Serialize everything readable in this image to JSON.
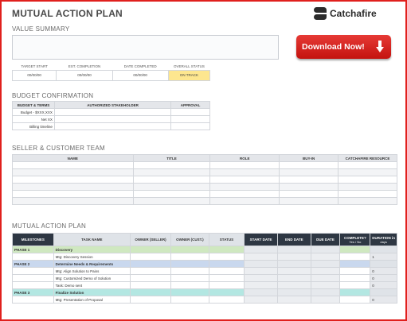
{
  "header": {
    "title": "MUTUAL ACTION PLAN",
    "logo_text": "Catchafire"
  },
  "download_button": {
    "label": "Download Now!"
  },
  "value_summary": {
    "title": "VALUE SUMMARY",
    "columns": [
      "TARGET START",
      "EST. COMPLETION",
      "DATE COMPLETED",
      "OVERALL STATUS"
    ],
    "values": [
      "00/00/00",
      "00/00/00",
      "00/00/00",
      "ON TRACK"
    ]
  },
  "budget": {
    "title": "BUDGET CONFIRMATION",
    "columns": [
      "BUDGET & TERMS",
      "AUTHORIZED STAKEHOLDER",
      "APPROVAL"
    ],
    "rows": [
      "Budget - $XXX,XXX",
      "Net XX",
      "Billing timeline"
    ]
  },
  "team": {
    "title": "SELLER & CUSTOMER TEAM",
    "columns": [
      "NAME",
      "TITLE",
      "ROLE",
      "BUY-IN",
      "CATCHAFIRE RESOURCE"
    ]
  },
  "plan": {
    "title": "MUTUAL ACTION PLAN",
    "columns": [
      "MILESTONES",
      "TASK NAME",
      "OWNER (SELLER)",
      "OWNER (CUST.)",
      "STATUS",
      "START DATE",
      "END DATE",
      "DUE DATE",
      "COMPLETE?",
      "DURATION in"
    ],
    "complete_sub": "Yes / No",
    "duration_sub": "days",
    "rows": [
      {
        "type": "phase",
        "milestone": "PHASE 1",
        "task": "Discovery",
        "duration": ""
      },
      {
        "type": "task",
        "milestone": "",
        "task": "Mtg: Discovery Session",
        "duration": "1"
      },
      {
        "type": "phase",
        "milestone": "PHASE 2",
        "task": "Determine Needs & Requirements",
        "duration": ""
      },
      {
        "type": "task",
        "milestone": "",
        "task": "Mtg: Align Solution to Pains",
        "duration": "0"
      },
      {
        "type": "task",
        "milestone": "",
        "task": "Mtg: Customized Demo of Solution",
        "duration": "0"
      },
      {
        "type": "task",
        "milestone": "",
        "task": "Task: Demo sent",
        "duration": "0"
      },
      {
        "type": "phase",
        "milestone": "PHASE 3",
        "task": "Finalize Solution",
        "duration": ""
      },
      {
        "type": "task",
        "milestone": "",
        "task": "Mtg: Presentation of Proposal",
        "duration": "0"
      }
    ]
  }
}
